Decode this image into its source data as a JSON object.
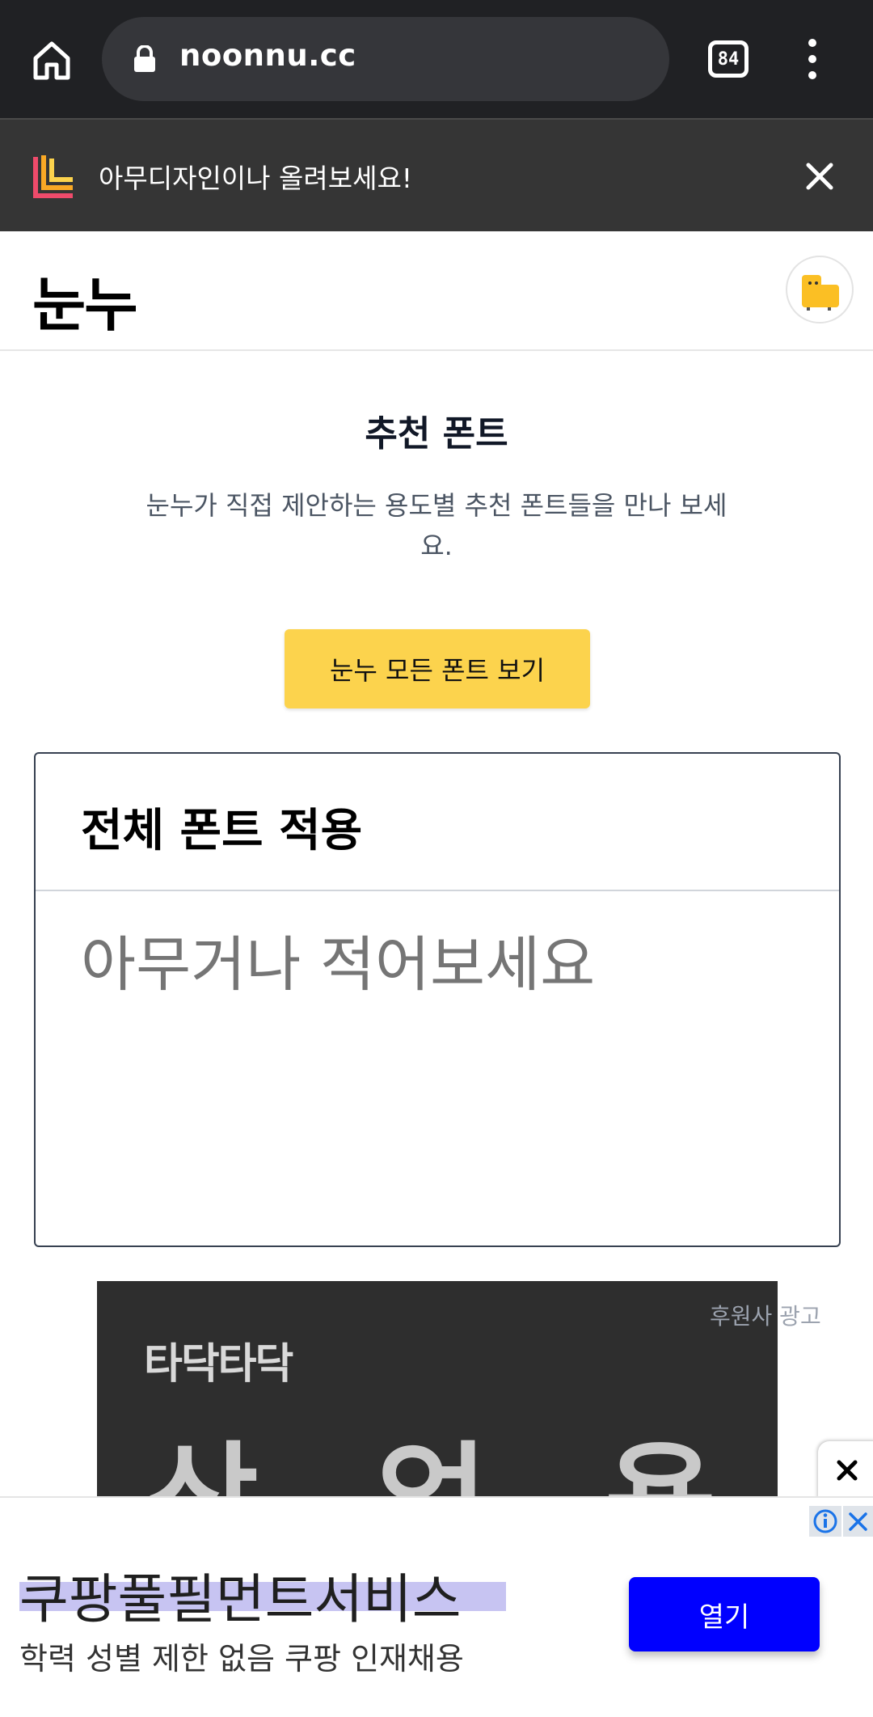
{
  "browser": {
    "url": "noonnu.cc",
    "tab_count": "84"
  },
  "banner": {
    "text": "아무디자인이나 올려보세요!"
  },
  "site": {
    "logo": "눈누"
  },
  "main": {
    "title": "추천 폰트",
    "description": "눈누가 직접 제안하는 용도별 추천 폰트들을 만나 보세요.",
    "cta_label": "눈누 모든 폰트 보기"
  },
  "editor": {
    "title": "전체 폰트 적용",
    "placeholder": "아무거나 적어보세요"
  },
  "sponsor": {
    "label": "후원사 광고",
    "image_small_text": "타닥타닥",
    "image_big_text_1": "상",
    "image_big_text_2": "업",
    "image_big_text_3": "용"
  },
  "bottom_ad": {
    "headline": "쿠팡풀필먼트서비스",
    "subtext": "학력 성별 제한 없음 쿠팡 인재채용",
    "button_label": "열기"
  },
  "colors": {
    "browser_bg": "#202124",
    "banner_bg": "#353535",
    "cta_yellow": "#fcd34d",
    "ad_button_blue": "#0000ff"
  }
}
